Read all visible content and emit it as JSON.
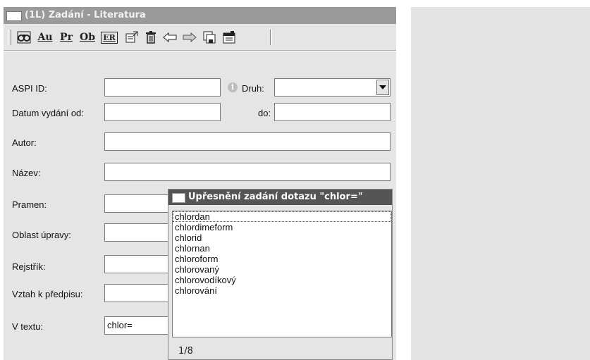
{
  "window": {
    "title": "(1L) Zadání - Literatura"
  },
  "toolbar": {
    "buttons": [
      {
        "id": "search",
        "icon": "binoculars-icon"
      },
      {
        "id": "au",
        "label": "Au"
      },
      {
        "id": "pr",
        "label": "Pr"
      },
      {
        "id": "ob",
        "label": "Ob"
      },
      {
        "id": "er",
        "label": "ER"
      },
      {
        "id": "props",
        "icon": "properties-icon"
      },
      {
        "id": "delete",
        "icon": "trash-icon"
      },
      {
        "id": "back",
        "icon": "arrow-left-icon"
      },
      {
        "id": "forward",
        "icon": "arrow-right-icon"
      },
      {
        "id": "save",
        "icon": "save-icon"
      },
      {
        "id": "open",
        "icon": "open-icon"
      }
    ]
  },
  "form": {
    "aspi_id": {
      "label": "ASPI ID:",
      "value": ""
    },
    "druh": {
      "label": "Druh:",
      "value": ""
    },
    "datum_od": {
      "label": "Datum vydání od:",
      "value": ""
    },
    "datum_do": {
      "label": "do:",
      "value": ""
    },
    "autor": {
      "label": "Autor:",
      "value": ""
    },
    "nazev": {
      "label": "Název:",
      "value": ""
    },
    "pramen": {
      "label": "Pramen:",
      "value": ""
    },
    "oblast": {
      "label": "Oblast úpravy:",
      "value": ""
    },
    "rejstrik": {
      "label": "Rejstřík:",
      "value": ""
    },
    "vztah": {
      "label": "Vztah k předpisu:",
      "value": ""
    },
    "v_textu": {
      "label": "V textu:",
      "value": "chlor="
    }
  },
  "popup": {
    "title": "Upřesnění zadání dotazu \"chlor=\"",
    "items": [
      "chlordan",
      "chlordimeform",
      "chlorid",
      "chlornan",
      "chloroform",
      "chlorovaný",
      "chlorovodíkový",
      "chlorování"
    ],
    "selected_index": 0,
    "counter": "1/8"
  }
}
